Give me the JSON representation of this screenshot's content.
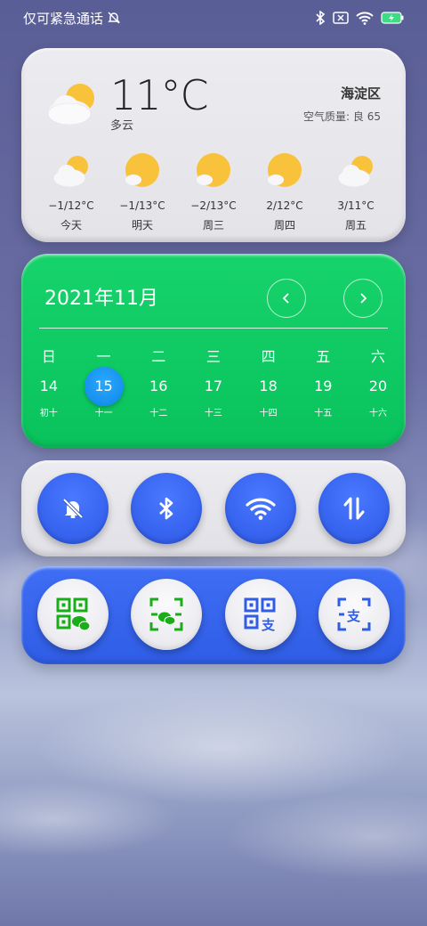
{
  "status_bar": {
    "carrier_text": "仅可紧急通话",
    "icons": [
      "silent-bell-icon",
      "bluetooth-icon",
      "no-sim-icon",
      "wifi-icon",
      "battery-charging-icon"
    ],
    "battery_color": "#3ddc84"
  },
  "weather": {
    "temperature": "11°C",
    "condition": "多云",
    "location": "海淀区",
    "air_quality": "空气质量: 良 65",
    "icon": "partly-cloudy-icon",
    "forecast": [
      {
        "temp": "−1/12°C",
        "day": "今天",
        "icon": "partly-cloudy-icon"
      },
      {
        "temp": "−1/13°C",
        "day": "明天",
        "icon": "sunny-cloud-icon"
      },
      {
        "temp": "−2/13°C",
        "day": "周三",
        "icon": "sunny-cloud-icon"
      },
      {
        "temp": "2/12°C",
        "day": "周四",
        "icon": "sunny-cloud-icon"
      },
      {
        "temp": "3/11°C",
        "day": "周五",
        "icon": "partly-cloudy-icon"
      }
    ]
  },
  "calendar": {
    "title": "2021年11月",
    "weekdays": [
      "日",
      "一",
      "二",
      "三",
      "四",
      "五",
      "六"
    ],
    "days": [
      "14",
      "15",
      "16",
      "17",
      "18",
      "19",
      "20"
    ],
    "lunar": [
      "初十",
      "十一",
      "十二",
      "十三",
      "十四",
      "十五",
      "十六"
    ],
    "today": "15",
    "accent_color": "#0fc862",
    "today_color": "#1a98f5"
  },
  "quick_toggles": {
    "items": [
      "silent-bell-icon",
      "bluetooth-icon",
      "wifi-icon",
      "mobile-data-icon"
    ],
    "button_color": "#3565f0"
  },
  "payment_shortcuts": {
    "items": [
      "wechat-pay-code-icon",
      "wechat-scan-icon",
      "alipay-pay-code-icon",
      "alipay-scan-icon"
    ],
    "wechat_color": "#1aad19",
    "alipay_color": "#2f5de6"
  }
}
